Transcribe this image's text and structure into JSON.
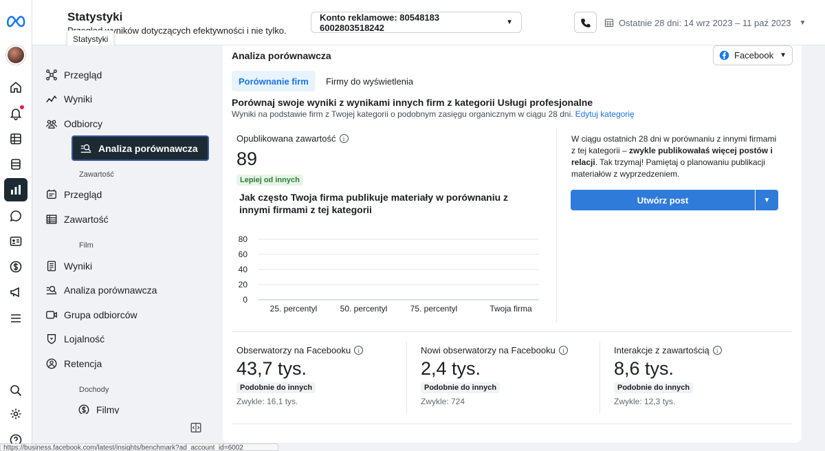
{
  "header": {
    "title": "Statystyki",
    "subtitle": "Przegląd wyników dotyczących efektywności i nie tylko.",
    "tooltip": "Statystyki",
    "account_label": "Konto reklamowe: 80548183 6002803518242",
    "date_range": "Ostatnie 28 dni: 14 wrz 2023 – 11 paź 2023"
  },
  "sidebar": {
    "items": [
      {
        "label": "Przegląd",
        "icon": "network-icon"
      },
      {
        "label": "Wyniki",
        "icon": "trend-icon"
      },
      {
        "label": "Odbiorcy",
        "icon": "people-icon"
      },
      {
        "label": "Analiza porównawcza",
        "icon": "benchmark-icon"
      }
    ],
    "section_content": "Zawartość",
    "content_items": [
      {
        "label": "Przegląd",
        "icon": "content-overview-icon"
      },
      {
        "label": "Zawartość",
        "icon": "table-icon"
      }
    ],
    "section_film": "Film",
    "film_items": [
      {
        "label": "Wyniki",
        "icon": "report-icon"
      },
      {
        "label": "Analiza porównawcza",
        "icon": "benchmark-icon"
      },
      {
        "label": "Grupa odbiorców",
        "icon": "video-icon"
      },
      {
        "label": "Lojalność",
        "icon": "shield-icon"
      },
      {
        "label": "Retencja",
        "icon": "user-circle-icon"
      }
    ],
    "section_income": "Dochody",
    "income_items": [
      {
        "label": "Filmy",
        "icon": "dollar-icon"
      }
    ]
  },
  "main": {
    "section_title": "Analiza porównawcza",
    "platform_select": "Facebook",
    "tabs": [
      {
        "label": "Porównanie firm"
      },
      {
        "label": "Firmy do wyświetlenia"
      }
    ],
    "compare_heading": "Porównaj swoje wyniki z wynikami innych firm z kategorii Usługi profesjonalne",
    "compare_desc": "Wyniki na podstawie firm z Twojej kategorii o podobnym zasięgu organicznym w ciągu 28 dni.",
    "edit_category": "Edytuj kategorię",
    "published_label": "Opublikowana zawartość",
    "published_value": "89",
    "published_badge": "Lepiej od innych",
    "chart_title": "Jak często Twoja firma publikuje materiały w porównaniu z innymi firmami z tej kategorii",
    "side_text_1": "W ciągu ostatnich 28 dni w porównaniu z innymi firmami z tej kategorii – ",
    "side_text_bold": "zwykle publikowałaś więcej postów i relacji",
    "side_text_2": ". Tak trzymaj! Pamiętaj o planowaniu publikacji materiałów z wyprzedzeniem.",
    "create_post": "Utwórz post",
    "stats": [
      {
        "label": "Obserwatorzy na Facebooku",
        "value": "43,7 tys.",
        "badge": "Podobnie do innych",
        "usual": "Zwykle: 16,1 tys."
      },
      {
        "label": "Nowi obserwatorzy na Facebooku",
        "value": "2,4 tys.",
        "badge": "Podobnie do innych",
        "usual": "Zwykle: 724"
      },
      {
        "label": "Interakcje z zawartością",
        "value": "8,6 tys.",
        "badge": "Podobnie do innych",
        "usual": "Zwykle: 12,3 tys."
      }
    ]
  },
  "status_url": "https://business.facebook.com/latest/insights/benchmark?ad_account_id=6002",
  "colors": {
    "accent": "#1b74e4",
    "active_nav": "#1c2b33",
    "button": "#2f7bd9"
  },
  "chart_data": {
    "type": "bar",
    "categories": [
      "25. percentyl",
      "50. percentyl",
      "75. percentyl",
      "Twoja firma"
    ],
    "values": [
      null,
      null,
      null,
      null
    ],
    "yticks": [
      "80",
      "60",
      "40",
      "20",
      "0"
    ],
    "ylim": [
      0,
      80
    ],
    "grid": true
  }
}
